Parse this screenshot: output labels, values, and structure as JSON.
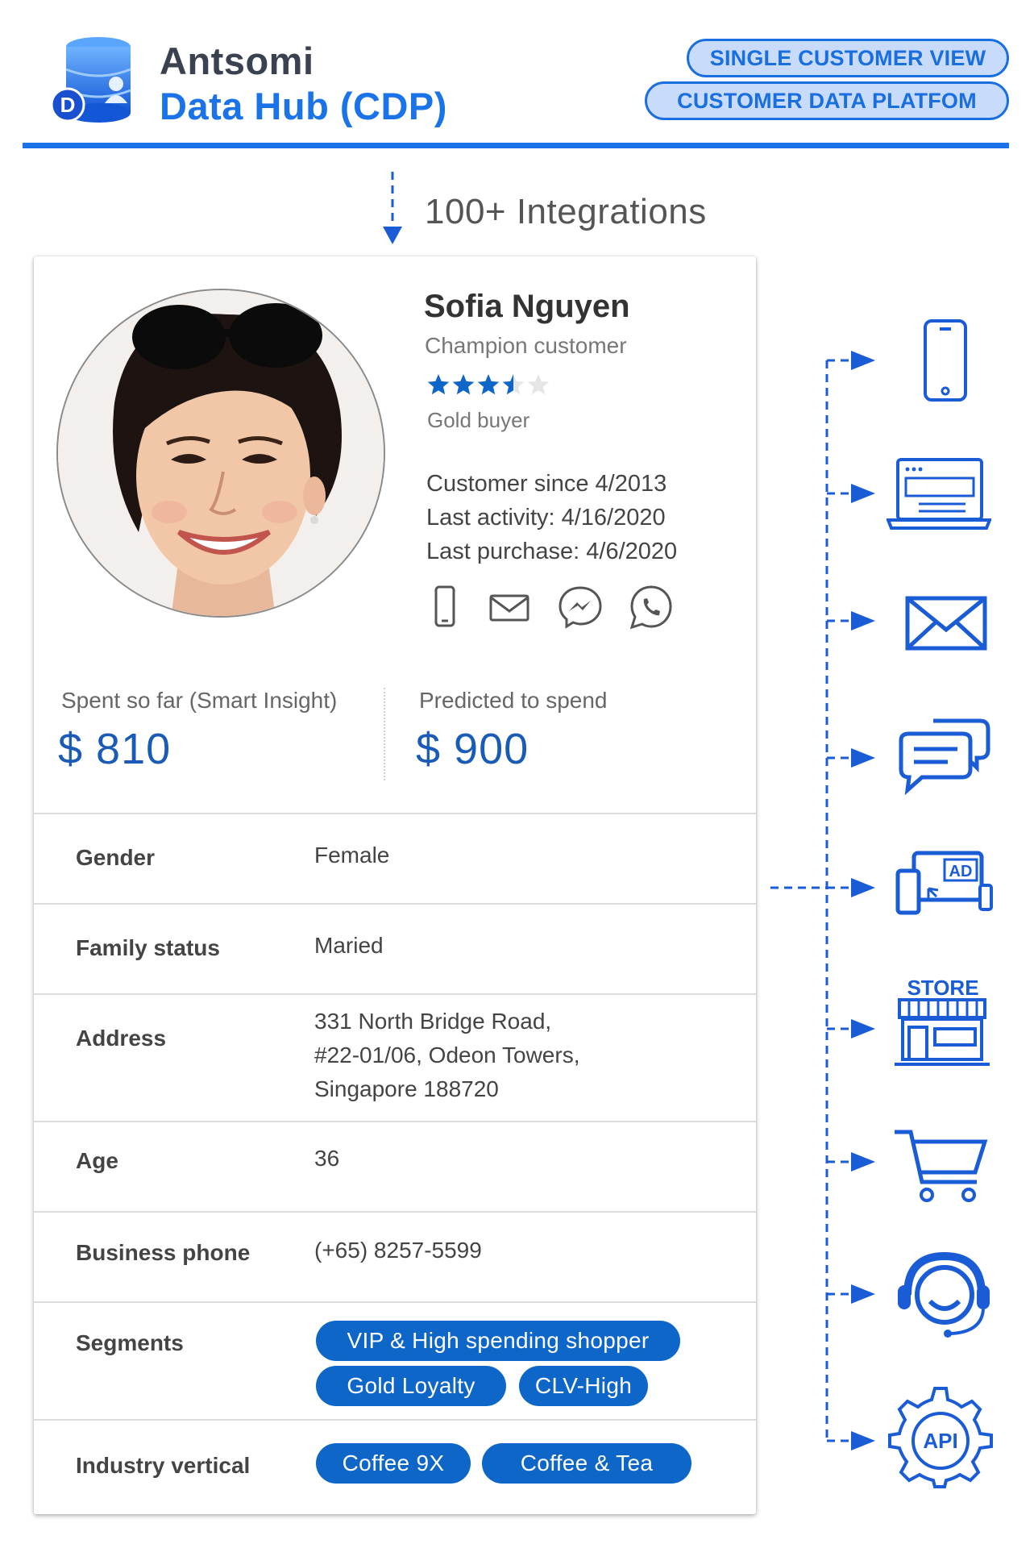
{
  "header": {
    "brand_line1": "Antsomi",
    "brand_line2": "Data Hub (CDP)",
    "tag1": "SINGLE CUSTOMER VIEW",
    "tag2": "CUSTOMER DATA PLATFOM",
    "logo_letter": "D"
  },
  "integrations": {
    "label": "100+ Integrations"
  },
  "profile": {
    "name": "Sofia Nguyen",
    "customer_type": "Champion customer",
    "rating": 3.5,
    "rating_max": 5,
    "buyer_level": "Gold buyer",
    "customer_since": "Customer since 4/2013",
    "last_activity": "Last activity: 4/16/2020",
    "last_purchase": "Last purchase: 4/6/2020"
  },
  "contacts": [
    "phone-icon",
    "email-icon",
    "messenger-icon",
    "whatsapp-icon"
  ],
  "money": {
    "spent_label": "Spent so far (Smart Insight)",
    "spent_value": "$ 810",
    "predicted_label": "Predicted to spend",
    "predicted_value": "$ 900"
  },
  "attributes": {
    "gender_label": "Gender",
    "gender_value": "Female",
    "family_label": "Family status",
    "family_value": "Maried",
    "address_label": "Address",
    "address_line1": "331 North Bridge Road,",
    "address_line2": "#22-01/06, Odeon Towers,",
    "address_line3": "Singapore 188720",
    "age_label": "Age",
    "age_value": "36",
    "phone_label": "Business phone",
    "phone_value": "(+65) 8257-5599",
    "segments_label": "Segments",
    "segments": [
      "VIP & High spending shopper",
      "Gold Loyalty",
      "CLV-High"
    ],
    "industry_label": "Industry vertical",
    "industries": [
      "Coffee 9X",
      "Coffee & Tea"
    ]
  },
  "channels": {
    "items": [
      "mobile-icon",
      "website-icon",
      "email-icon",
      "chat-icon",
      "ads-icon",
      "store-icon",
      "cart-icon",
      "support-icon",
      "api-icon"
    ],
    "store_text": "STORE",
    "ad_text": "AD",
    "api_text": "API"
  },
  "colors": {
    "accent": "#1a73e8",
    "chip": "#0e66c8",
    "tag_bg": "#c9dbfb"
  }
}
